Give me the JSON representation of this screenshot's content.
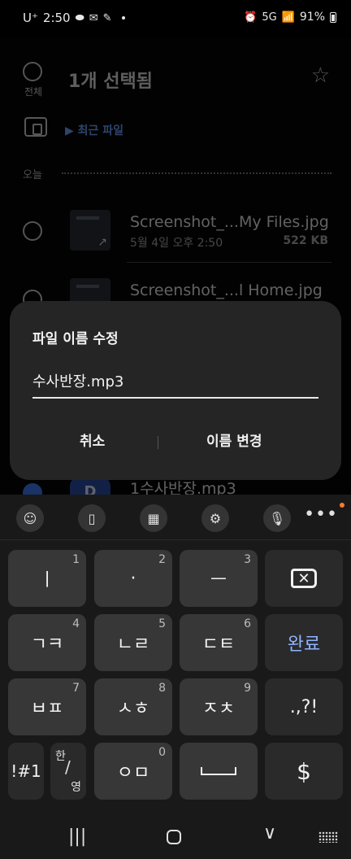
{
  "status_bar": {
    "carrier": "U⁺",
    "time": "2:50",
    "signal": "5G",
    "battery_percent": "91%"
  },
  "file_list": {
    "select_all_label": "전체",
    "selection_title": "1개 선택됨",
    "breadcrumb": "▶ 최근 파일",
    "section_header": "오늘",
    "files": [
      {
        "name": "Screenshot_...My Files.jpg",
        "date": "5월 4일 오후 2:50",
        "size": "522 KB"
      },
      {
        "name": "Screenshot_...l Home.jpg",
        "date": "",
        "size": ""
      },
      {
        "name": "1수사반장.mp3",
        "thumb_letter": "D",
        "selected": true
      }
    ]
  },
  "dialog": {
    "title": "파일 이름 수정",
    "field_value": "수사반장.mp3",
    "cancel_label": "취소",
    "rename_label": "이름 변경"
  },
  "keyboard": {
    "toolbar": [
      "emoji-icon",
      "clipboard-icon",
      "keyboard-layout-icon",
      "settings-icon",
      "mic-icon",
      "more-icon"
    ],
    "more_label": "•••",
    "rows": [
      [
        {
          "label": "ㅣ",
          "num": "1"
        },
        {
          "label": "·",
          "num": "2"
        },
        {
          "label": "ㅡ",
          "num": "3"
        },
        {
          "label": "⌫",
          "num": ""
        }
      ],
      [
        {
          "label": "ㄱㅋ",
          "num": "4"
        },
        {
          "label": "ㄴㄹ",
          "num": "5"
        },
        {
          "label": "ㄷㅌ",
          "num": "6"
        },
        {
          "label": "완료",
          "num": ""
        }
      ],
      [
        {
          "label": "ㅂㅍ",
          "num": "7"
        },
        {
          "label": "ㅅㅎ",
          "num": "8"
        },
        {
          "label": "ㅈㅊ",
          "num": "9"
        },
        {
          "label": ".,?!",
          "num": ""
        }
      ],
      [
        {
          "label": "!#1",
          "num": ""
        },
        {
          "label": "한/영",
          "num": ""
        },
        {
          "label": "ㅇㅁ",
          "num": "0"
        },
        {
          "label": "space",
          "num": ""
        },
        {
          "label": "$",
          "num": ""
        }
      ]
    ],
    "han_label": "한",
    "eng_label": "영",
    "slash": "/"
  },
  "nav": {
    "recents": "|||",
    "back": "∨"
  },
  "colors": {
    "accent_blue": "#6fa2ff",
    "done_key": "#8fb3ff",
    "notify_dot": "#ff7a2a"
  }
}
